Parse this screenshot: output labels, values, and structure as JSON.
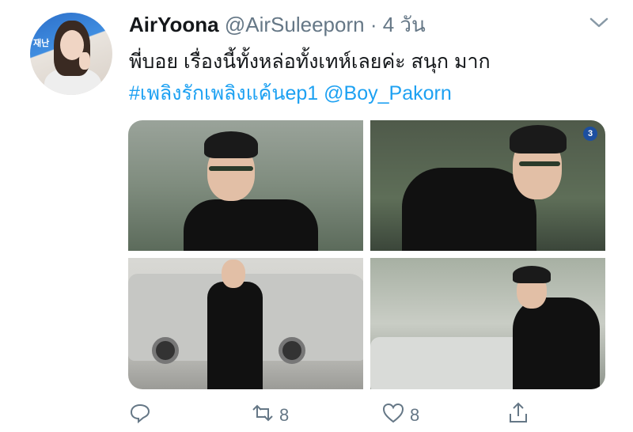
{
  "tweet": {
    "display_name": "AirYoona",
    "handle": "@AirSuleeporn",
    "separator": "·",
    "time": "4 วัน",
    "text_line1": "พี่บอย เรื่องนี้ทั้งหล่อทั้งเทห์เลยค่ะ สนุก มาก",
    "hashtag": "#เพลิงรักเพลิงแค้นep1",
    "mention": "@Boy_Pakorn"
  },
  "avatar": {
    "sign_text": "재난"
  },
  "media": {
    "channel_logo": "3"
  },
  "actions": {
    "reply_icon": "reply-icon",
    "retweet_icon": "retweet-icon",
    "retweet_count": "8",
    "like_icon": "heart-icon",
    "like_count": "8",
    "share_icon": "share-icon"
  },
  "colors": {
    "link": "#1da1f2",
    "muted": "#657786",
    "text": "#14171a"
  }
}
